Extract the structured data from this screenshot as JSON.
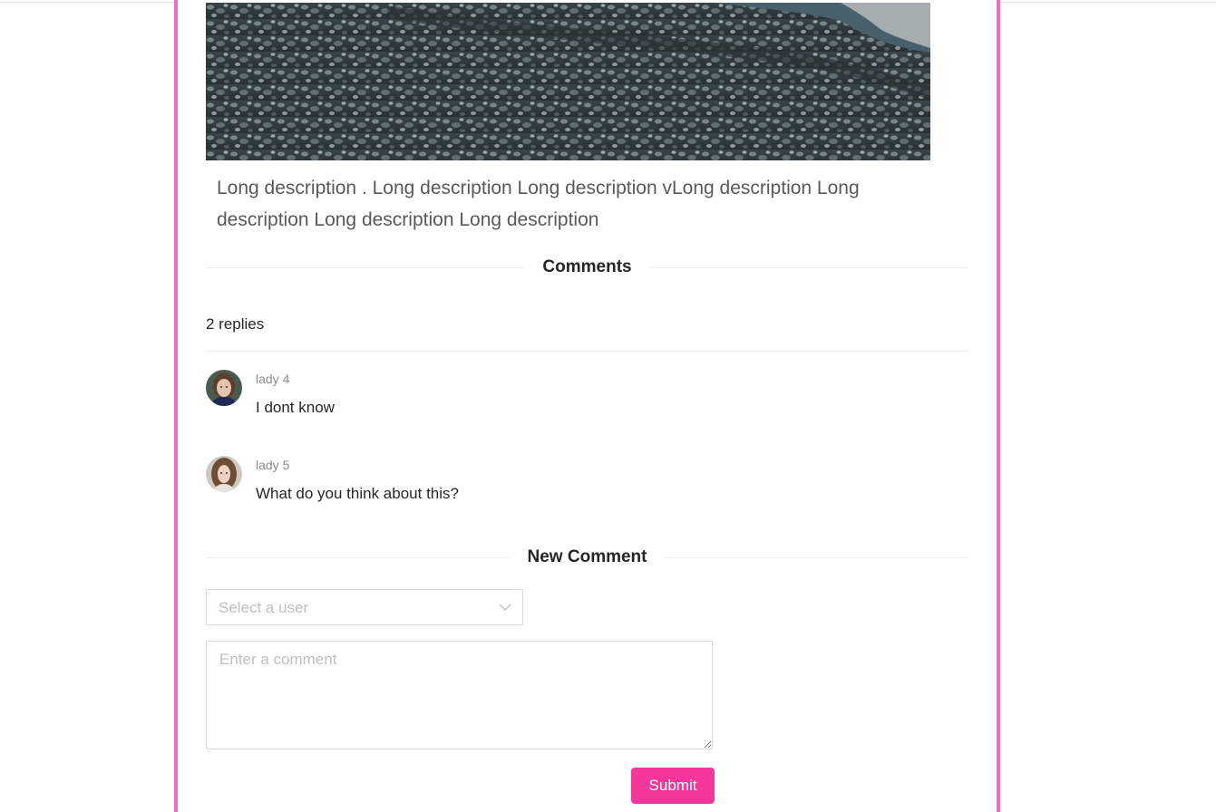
{
  "post": {
    "description": "Long description . Long description Long description vLong description Long description Long description Long description"
  },
  "comments": {
    "heading": "Comments",
    "count_text": "2 replies",
    "items": [
      {
        "author": "lady 4",
        "text": "I dont know"
      },
      {
        "author": "lady 5",
        "text": "What do you think about this?"
      }
    ]
  },
  "new_comment": {
    "heading": "New Comment",
    "user_select_placeholder": "Select a user",
    "comment_placeholder": "Enter a comment",
    "submit_label": "Submit"
  },
  "colors": {
    "panel_border": "#ee6ec6",
    "submit_button": "#f5379b"
  },
  "icons": {
    "select_arrow": "chevron-down-icon"
  }
}
